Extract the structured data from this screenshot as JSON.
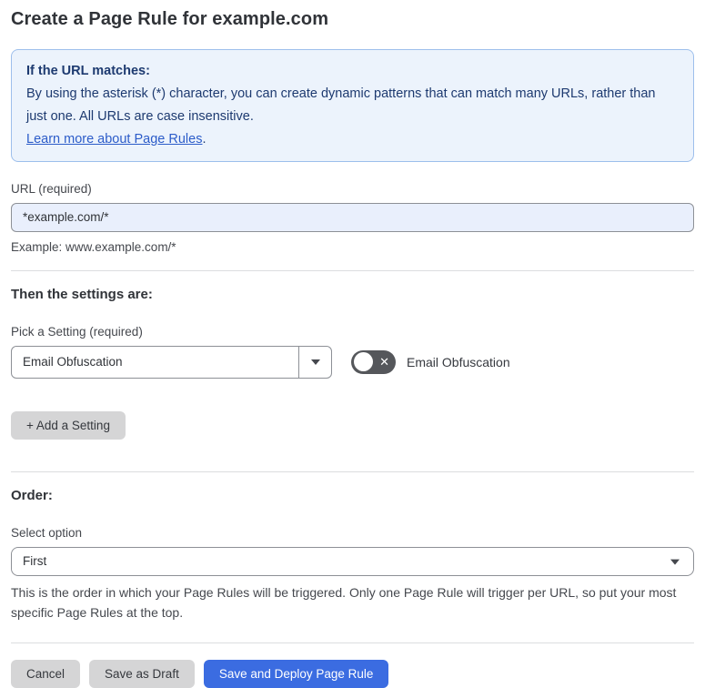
{
  "page": {
    "title": "Create a Page Rule for example.com"
  },
  "info_box": {
    "heading": "If the URL matches:",
    "body": "By using the asterisk (*) character, you can create dynamic patterns that can match many URLs, rather than just one. All URLs are case insensitive.",
    "link_label": "Learn more about Page Rules",
    "link_suffix": "."
  },
  "url_section": {
    "label": "URL (required)",
    "value": "*example.com/*",
    "example": "Example: www.example.com/*"
  },
  "settings_section": {
    "heading": "Then the settings are:",
    "picker_label": "Pick a Setting (required)",
    "picker_value": "Email Obfuscation",
    "toggle_state": "off",
    "toggle_label": "Email Obfuscation",
    "add_button_label": "+ Add a Setting"
  },
  "order_section": {
    "heading": "Order:",
    "select_label": "Select option",
    "select_value": "First",
    "help_text": "This is the order in which your Page Rules will be triggered. Only one Page Rule will trigger per URL, so put your most specific Page Rules at the top."
  },
  "footer": {
    "cancel_label": "Cancel",
    "save_draft_label": "Save as Draft",
    "save_deploy_label": "Save and Deploy Page Rule"
  },
  "icons": {
    "toggle_off_glyph": "✕"
  },
  "colors": {
    "info_box_background": "#ecf3fc",
    "info_box_border": "#9dbfec",
    "info_text": "#1d3a70",
    "link_blue": "#2c5cc9",
    "url_input_background": "#e9effc",
    "control_border": "#8d9096",
    "divider": "#dcdddf",
    "gray_button": "#d5d5d6",
    "primary_button": "#3b6ce1",
    "toggle_off_background": "#55575b"
  }
}
